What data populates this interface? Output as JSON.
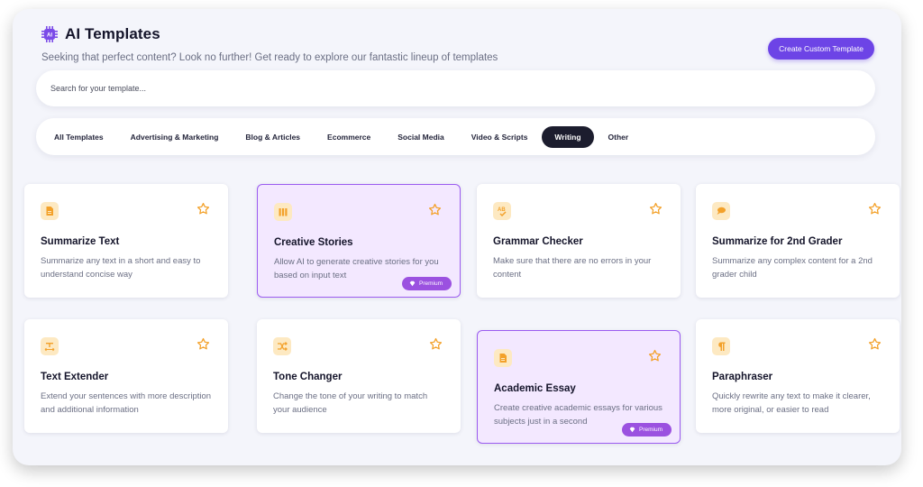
{
  "header": {
    "title": "AI Templates",
    "subtitle": "Seeking that perfect content? Look no further! Get ready to explore our fantastic lineup of templates",
    "create_button": "Create Custom Template",
    "icon": "ai-chip-icon"
  },
  "search": {
    "placeholder": "Search for your template..."
  },
  "tabs": [
    {
      "label": "All Templates",
      "active": false
    },
    {
      "label": "Advertising & Marketing",
      "active": false
    },
    {
      "label": "Blog & Articles",
      "active": false
    },
    {
      "label": "Ecommerce",
      "active": false
    },
    {
      "label": "Social Media",
      "active": false
    },
    {
      "label": "Video & Scripts",
      "active": false
    },
    {
      "label": "Writing",
      "active": true
    },
    {
      "label": "Other",
      "active": false
    }
  ],
  "cards": [
    {
      "title": "Summarize Text",
      "desc": "Summarize any text in a short and easy to understand concise way",
      "premium": false,
      "icon": "document-icon"
    },
    {
      "title": "Creative Stories",
      "desc": "Allow AI to generate creative stories for you based on input text",
      "premium": true,
      "icon": "books-icon"
    },
    {
      "title": "Grammar Checker",
      "desc": "Make sure that there are no errors in your content",
      "premium": false,
      "icon": "abc-check-icon"
    },
    {
      "title": "Summarize for 2nd Grader",
      "desc": "Summarize any complex content for a 2nd grader child",
      "premium": false,
      "icon": "speech-bubble-icon"
    },
    {
      "title": "Text Extender",
      "desc": "Extend your sentences with more description and additional information",
      "premium": false,
      "icon": "text-expand-icon"
    },
    {
      "title": "Tone Changer",
      "desc": "Change the tone of your writing to match your audience",
      "premium": false,
      "icon": "shuffle-icon"
    },
    {
      "title": "Academic Essay",
      "desc": "Create creative academic essays for various subjects just in a second",
      "premium": true,
      "icon": "document-icon"
    },
    {
      "title": "Paraphraser",
      "desc": "Quickly rewrite any text to make it clearer, more original, or easier to read",
      "premium": false,
      "icon": "pilcrow-icon"
    }
  ],
  "premium_label": "Premium",
  "colors": {
    "accent": "#6d44e6",
    "premium_bg": "#f3e8ff",
    "premium_border": "#9b5cf0",
    "icon_bg": "#fde9c2",
    "icon_fg": "#f3a12a",
    "active_tab": "#1c1d2e"
  }
}
